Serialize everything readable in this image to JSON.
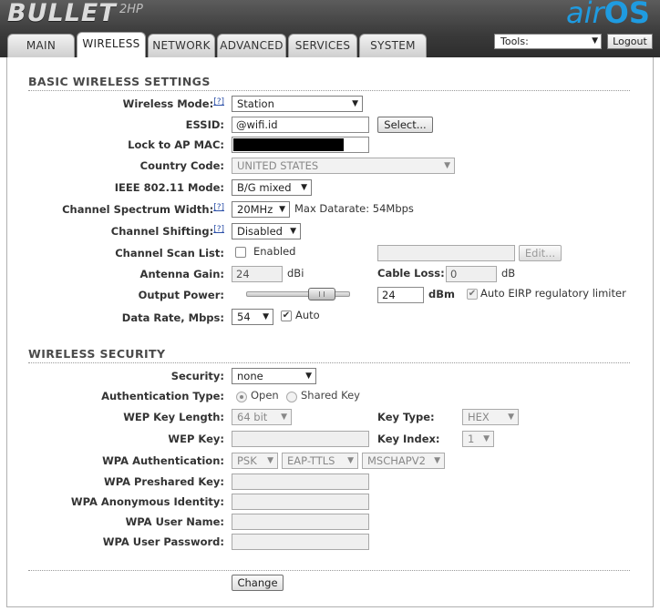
{
  "header": {
    "logo_product": "BULLET",
    "logo_model": "2HP",
    "logo_brand_air": "air",
    "logo_brand_os": "OS",
    "brand_color": "#1f9be0"
  },
  "tabs": [
    {
      "label": "MAIN"
    },
    {
      "label": "WIRELESS",
      "active": true
    },
    {
      "label": "NETWORK"
    },
    {
      "label": "ADVANCED"
    },
    {
      "label": "SERVICES"
    },
    {
      "label": "SYSTEM"
    }
  ],
  "toolbar": {
    "tools_label": "Tools:",
    "logout_label": "Logout"
  },
  "basic": {
    "title": "BASIC WIRELESS SETTINGS",
    "wireless_mode": {
      "label": "Wireless Mode:",
      "help": "[?]",
      "value": "Station"
    },
    "essid": {
      "label": "ESSID:",
      "value": "@wifi.id",
      "select_button": "Select..."
    },
    "lock_ap_mac": {
      "label": "Lock to AP MAC:"
    },
    "country_code": {
      "label": "Country Code:",
      "value": "UNITED STATES"
    },
    "ieee_mode": {
      "label": "IEEE 802.11 Mode:",
      "value": "B/G mixed"
    },
    "channel_width": {
      "label": "Channel Spectrum Width:",
      "help": "[?]",
      "value": "20MHz",
      "max_datarate": "Max Datarate: 54Mbps"
    },
    "channel_shifting": {
      "label": "Channel Shifting:",
      "help": "[?]",
      "value": "Disabled"
    },
    "channel_scan": {
      "label": "Channel Scan List:",
      "enabled_label": "Enabled",
      "edit_button": "Edit..."
    },
    "antenna_gain": {
      "label": "Antenna Gain:",
      "value": "24",
      "unit": "dBi"
    },
    "cable_loss": {
      "label": "Cable Loss:",
      "value": "0",
      "unit": "dB"
    },
    "output_power": {
      "label": "Output Power:",
      "value": "24",
      "unit": "dBm",
      "eirp_label": "Auto EIRP regulatory limiter"
    },
    "data_rate": {
      "label": "Data Rate, Mbps:",
      "value": "54",
      "auto_label": "Auto"
    }
  },
  "security": {
    "title": "WIRELESS SECURITY",
    "security": {
      "label": "Security:",
      "value": "none"
    },
    "auth_type": {
      "label": "Authentication Type:",
      "open": "Open",
      "shared": "Shared Key"
    },
    "wep_key_length": {
      "label": "WEP Key Length:",
      "value": "64 bit"
    },
    "key_type": {
      "label": "Key Type:",
      "value": "HEX"
    },
    "wep_key": {
      "label": "WEP Key:",
      "value": ""
    },
    "key_index": {
      "label": "Key Index:",
      "value": "1"
    },
    "wpa_auth": {
      "label": "WPA Authentication:",
      "psk": "PSK",
      "eap": "EAP-TTLS",
      "mschap": "MSCHAPV2"
    },
    "wpa_psk": {
      "label": "WPA Preshared Key:",
      "value": ""
    },
    "wpa_anon": {
      "label": "WPA Anonymous Identity:",
      "value": ""
    },
    "wpa_user": {
      "label": "WPA User Name:",
      "value": ""
    },
    "wpa_pass": {
      "label": "WPA User Password:",
      "value": ""
    }
  },
  "change_button": "Change"
}
